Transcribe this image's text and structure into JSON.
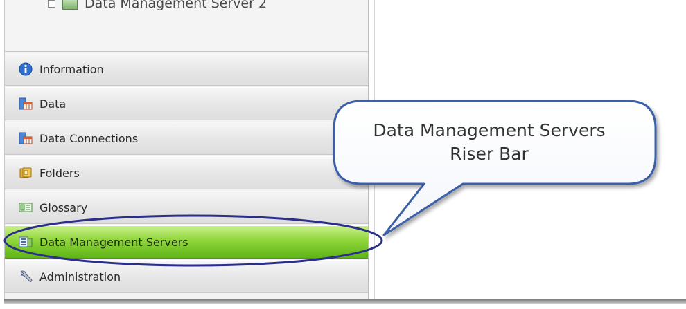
{
  "tree": {
    "node_label": "Data Management Server 2"
  },
  "risers": [
    {
      "label": "Information",
      "icon": "info-icon"
    },
    {
      "label": "Data",
      "icon": "data-table-icon"
    },
    {
      "label": "Data Connections",
      "icon": "data-connections-icon"
    },
    {
      "label": "Folders",
      "icon": "folder-icon"
    },
    {
      "label": "Glossary",
      "icon": "glossary-icon"
    },
    {
      "label": "Data Management Servers",
      "icon": "server-icon",
      "active": true
    },
    {
      "label": "Administration",
      "icon": "wrench-icon"
    }
  ],
  "callout": {
    "line1": "Data Management Servers",
    "line2": "Riser Bar"
  },
  "colors": {
    "active_riser": "#8fd63a",
    "highlight_ellipse": "#2b2f8a",
    "callout_border": "#3b5ea8"
  }
}
